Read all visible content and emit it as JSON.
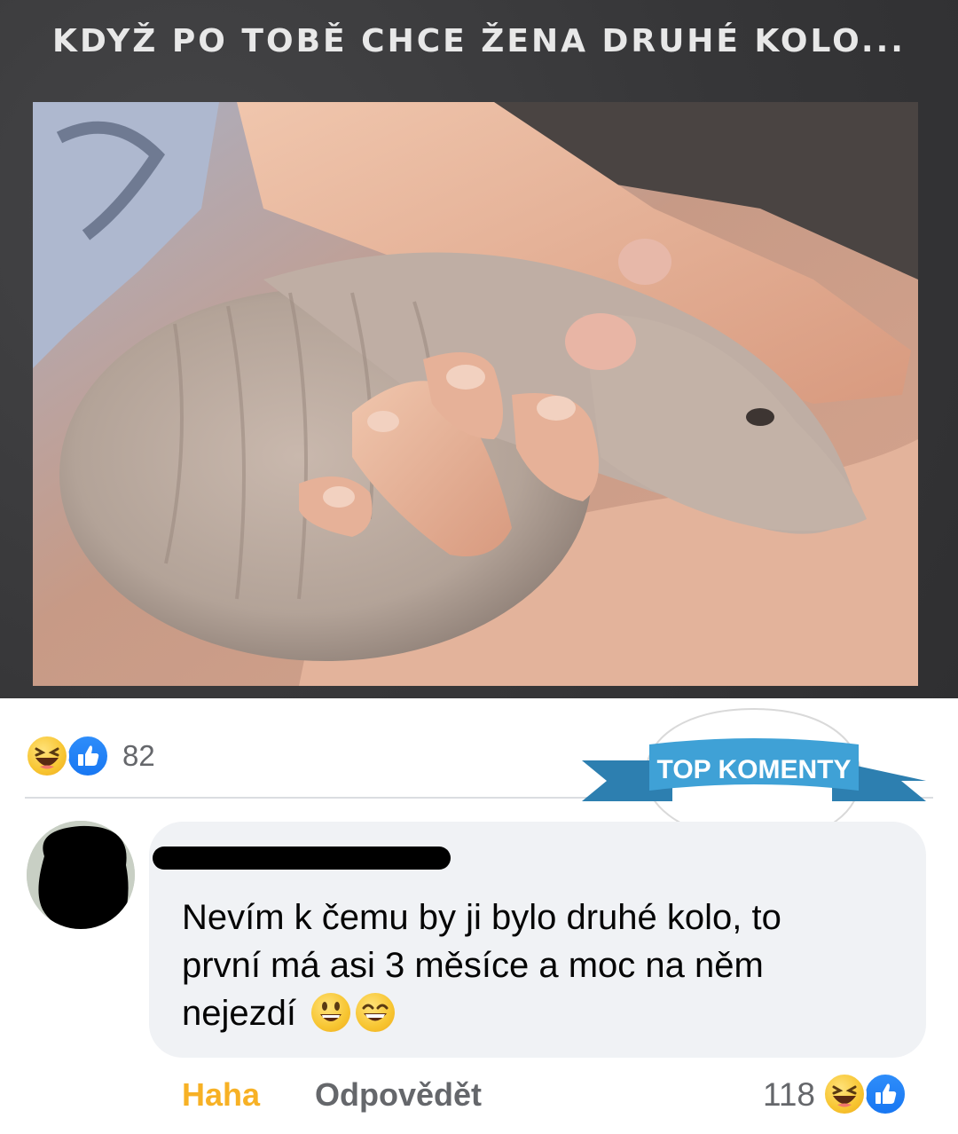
{
  "post": {
    "caption": "KDYŽ PO TOBĚ CHCE ŽENA DRUHÉ KOLO...",
    "reactions": {
      "icons": [
        "haha-icon",
        "like-icon"
      ],
      "count": "82"
    }
  },
  "badge": {
    "label": "TOP KOMENTY",
    "ribbon_color": "#3fa1d6"
  },
  "comment": {
    "text_line1": "Nevím k čemu by ji bylo druhé kolo, to",
    "text_line2": "první má asi 3 měsíce a moc na něm",
    "text_line3": "nejezdí",
    "emojis": [
      "grinning-face-icon",
      "grinning-face-smiling-eyes-icon"
    ],
    "actions": {
      "haha_label": "Haha",
      "reply_label": "Odpovědět"
    },
    "reaction_count": "118",
    "reaction_icons": [
      "haha-icon",
      "like-icon"
    ]
  },
  "colors": {
    "haha_active": "#f7b125",
    "facebook_blue": "#1877f2",
    "bubble_bg": "#f0f2f5"
  }
}
